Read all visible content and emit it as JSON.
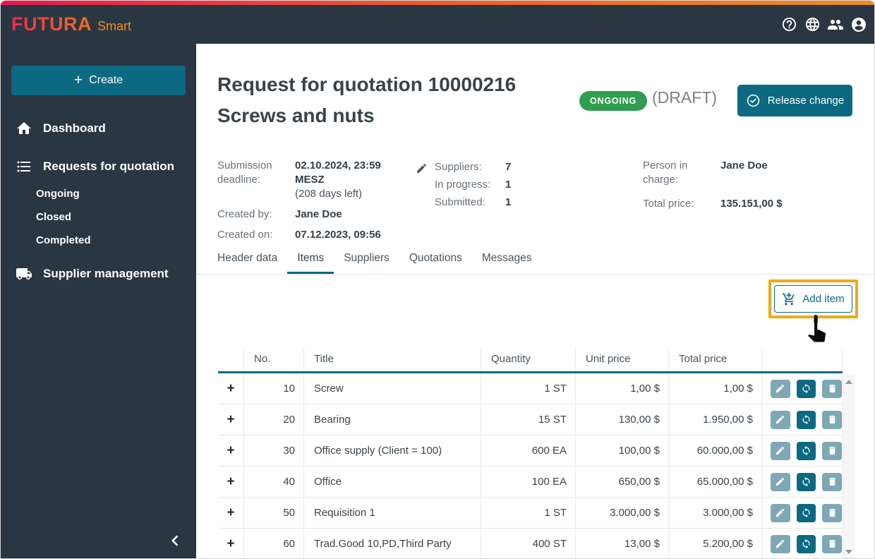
{
  "brand": {
    "name": "FUTURA",
    "suffix": "Smart"
  },
  "sidebar": {
    "create_button": "Create",
    "nav": [
      {
        "label": "Dashboard"
      },
      {
        "label": "Requests for quotation"
      },
      {
        "label": "Supplier management"
      }
    ],
    "sub_nav": [
      "Ongoing",
      "Closed",
      "Completed"
    ]
  },
  "page": {
    "title_line1": "Request for quotation 10000216",
    "title_line2": "Screws and nuts",
    "status_badge": "ONGOING",
    "draft_label": "(DRAFT)",
    "release_button": "Release change"
  },
  "details": {
    "submission_label": "Submission deadline:",
    "submission_value": "02.10.2024, 23:59 MESZ",
    "submission_note": "(208 days left)",
    "created_by_label": "Created by:",
    "created_by_value": "Jane Doe",
    "created_on_label": "Created on:",
    "created_on_value": "07.12.2023, 09:56",
    "suppliers_label": "Suppliers:",
    "suppliers_value": "7",
    "in_progress_label": "In progress:",
    "in_progress_value": "1",
    "submitted_label": "Submitted:",
    "submitted_value": "1",
    "person_label": "Person in charge:",
    "person_value": "Jane Doe",
    "total_label": "Total price:",
    "total_value": "135.151,00 $"
  },
  "tabs": [
    {
      "label": "Header data"
    },
    {
      "label": "Items"
    },
    {
      "label": "Suppliers"
    },
    {
      "label": "Quotations"
    },
    {
      "label": "Messages"
    }
  ],
  "toolbar": {
    "add_item_button": "Add item"
  },
  "table": {
    "headers": {
      "no": "No.",
      "title": "Title",
      "quantity": "Quantity",
      "unit_price": "Unit price",
      "total_price": "Total price"
    },
    "rows": [
      {
        "no": "10",
        "title": "Screw",
        "quantity": "1 ST",
        "unit_price": "1,00 $",
        "total_price": "1,00 $"
      },
      {
        "no": "20",
        "title": "Bearing",
        "quantity": "15 ST",
        "unit_price": "130,00 $",
        "total_price": "1.950,00 $"
      },
      {
        "no": "30",
        "title": "Office supply (Client = 100)",
        "quantity": "600 EA",
        "unit_price": "100,00 $",
        "total_price": "60.000,00 $"
      },
      {
        "no": "40",
        "title": "Office",
        "quantity": "100 EA",
        "unit_price": "650,00 $",
        "total_price": "65.000,00 $"
      },
      {
        "no": "50",
        "title": "Requisition 1",
        "quantity": "1 ST",
        "unit_price": "3.000,00 $",
        "total_price": "3.000,00 $"
      },
      {
        "no": "60",
        "title": "Trad.Good 10,PD,Third Party",
        "quantity": "400 ST",
        "unit_price": "13,00 $",
        "total_price": "5.200,00 $"
      }
    ]
  },
  "colors": {
    "accent_teal": "#0b6982",
    "badge_green": "#2f9e50",
    "highlight_orange": "#efa912",
    "dark_background": "#2a3641",
    "gradient_start": "#ed174f",
    "gradient_end": "#f28a1e",
    "action_light": "#7ea8b5"
  }
}
